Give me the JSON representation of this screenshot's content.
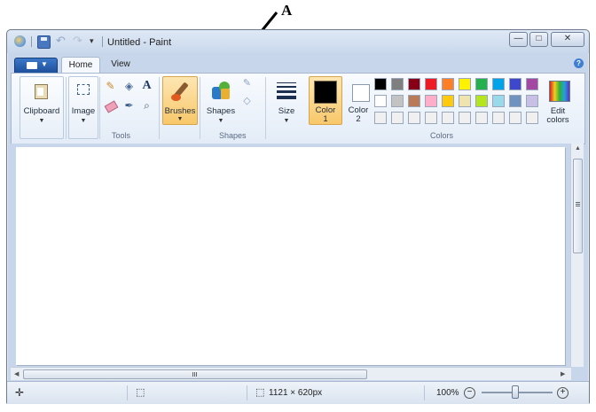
{
  "annotation": {
    "label": "A"
  },
  "window": {
    "title": "Untitled - Paint"
  },
  "controls": {
    "minimize": "—",
    "maximize": "□",
    "close": "✕"
  },
  "tabs": [
    {
      "label": "Home"
    },
    {
      "label": "View"
    }
  ],
  "ribbon": {
    "clipboard": {
      "label": "Clipboard"
    },
    "image": {
      "label": "Image"
    },
    "tools_group": "Tools",
    "brushes": {
      "label": "Brushes"
    },
    "shapes": {
      "label": "Shapes"
    },
    "shapes_group": "Shapes",
    "size": {
      "label": "Size"
    },
    "color1": {
      "label": "Color",
      "sub": "1",
      "value": "#000000"
    },
    "color2": {
      "label": "Color",
      "sub": "2",
      "value": "#ffffff"
    },
    "colors_group": "Colors",
    "edit_colors": {
      "line1": "Edit",
      "line2": "colors"
    },
    "palette_row1": [
      "#000000",
      "#7f7f7f",
      "#880015",
      "#ed1c24",
      "#ff7f27",
      "#fff200",
      "#22b14c",
      "#00a2e8",
      "#3f48cc",
      "#a349a4"
    ],
    "palette_row2": [
      "#ffffff",
      "#c3c3c3",
      "#b97a57",
      "#ffaec9",
      "#ffc90e",
      "#efe4b0",
      "#b5e61d",
      "#99d9ea",
      "#7092be",
      "#c8bfe7"
    ],
    "palette_row3": [
      "#f0f0f0",
      "#f0f0f0",
      "#f0f0f0",
      "#f0f0f0",
      "#f0f0f0",
      "#f0f0f0",
      "#f0f0f0",
      "#f0f0f0",
      "#f0f0f0",
      "#f0f0f0"
    ]
  },
  "statusbar": {
    "dimensions": "1121 × 620px",
    "zoom": "100%"
  }
}
